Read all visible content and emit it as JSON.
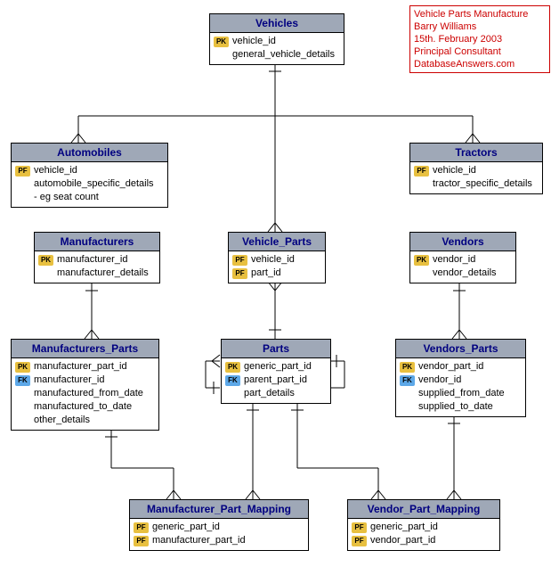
{
  "meta": {
    "line1": "Vehicle Parts Manufacture",
    "line2": "Barry Williams",
    "line3": "15th. February 2003",
    "line4": "Principal Consultant",
    "line5": "DatabaseAnswers.com"
  },
  "entities": {
    "vehicles": {
      "title": "Vehicles",
      "rows": [
        {
          "key": "PK",
          "name": "vehicle_id"
        },
        {
          "key": "",
          "name": "general_vehicle_details"
        }
      ]
    },
    "automobiles": {
      "title": "Automobiles",
      "rows": [
        {
          "key": "PF",
          "name": "vehicle_id"
        },
        {
          "key": "",
          "name": "automobile_specific_details"
        },
        {
          "key": "",
          "name": "- eg seat count"
        }
      ]
    },
    "tractors": {
      "title": "Tractors",
      "rows": [
        {
          "key": "PF",
          "name": "vehicle_id"
        },
        {
          "key": "",
          "name": "tractor_specific_details"
        }
      ]
    },
    "manufacturers": {
      "title": "Manufacturers",
      "rows": [
        {
          "key": "PK",
          "name": "manufacturer_id"
        },
        {
          "key": "",
          "name": "manufacturer_details"
        }
      ]
    },
    "vehicle_parts": {
      "title": "Vehicle_Parts",
      "rows": [
        {
          "key": "PF",
          "name": "vehicle_id"
        },
        {
          "key": "PF",
          "name": "part_id"
        }
      ]
    },
    "vendors": {
      "title": "Vendors",
      "rows": [
        {
          "key": "PK",
          "name": "vendor_id"
        },
        {
          "key": "",
          "name": "vendor_details"
        }
      ]
    },
    "manufacturers_parts": {
      "title": "Manufacturers_Parts",
      "rows": [
        {
          "key": "PK",
          "name": "manufacturer_part_id"
        },
        {
          "key": "FK",
          "name": "manufacturer_id"
        },
        {
          "key": "",
          "name": "manufactured_from_date"
        },
        {
          "key": "",
          "name": "manufactured_to_date"
        },
        {
          "key": "",
          "name": "other_details"
        }
      ]
    },
    "parts": {
      "title": "Parts",
      "rows": [
        {
          "key": "PK",
          "name": "generic_part_id"
        },
        {
          "key": "FK",
          "name": "parent_part_id"
        },
        {
          "key": "",
          "name": "part_details"
        }
      ]
    },
    "vendors_parts": {
      "title": "Vendors_Parts",
      "rows": [
        {
          "key": "PK",
          "name": "vendor_part_id"
        },
        {
          "key": "FK",
          "name": "vendor_id"
        },
        {
          "key": "",
          "name": "supplied_from_date"
        },
        {
          "key": "",
          "name": "supplied_to_date"
        }
      ]
    },
    "manufacturer_part_mapping": {
      "title": "Manufacturer_Part_Mapping",
      "rows": [
        {
          "key": "PF",
          "name": "generic_part_id"
        },
        {
          "key": "PF",
          "name": "manufacturer_part_id"
        }
      ]
    },
    "vendor_part_mapping": {
      "title": "Vendor_Part_Mapping",
      "rows": [
        {
          "key": "PF",
          "name": "generic_part_id"
        },
        {
          "key": "PF",
          "name": "vendor_part_id"
        }
      ]
    }
  }
}
